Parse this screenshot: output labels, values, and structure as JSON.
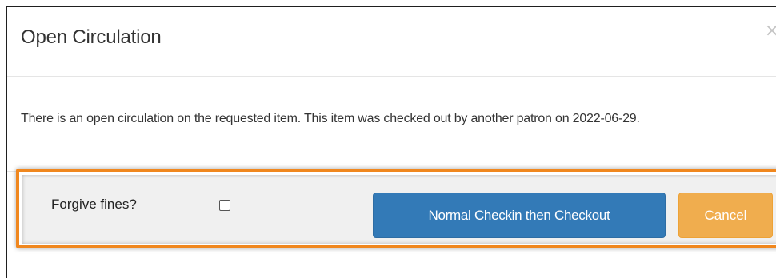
{
  "dialog": {
    "title": "Open Circulation",
    "close_glyph": "×",
    "body_text": "There is an open circulation on the requested item. This item was checked out by another patron on 2022-06-29.",
    "footer": {
      "forgive_label": "Forgive fines?",
      "forgive_checked": false,
      "primary_button": "Normal Checkin then Checkout",
      "cancel_button": "Cancel"
    }
  },
  "colors": {
    "primary": "#337ab7",
    "warning": "#f0ad4e",
    "highlight": "#f0871e",
    "text": "#333333"
  },
  "icons": {
    "close": "close-icon"
  }
}
